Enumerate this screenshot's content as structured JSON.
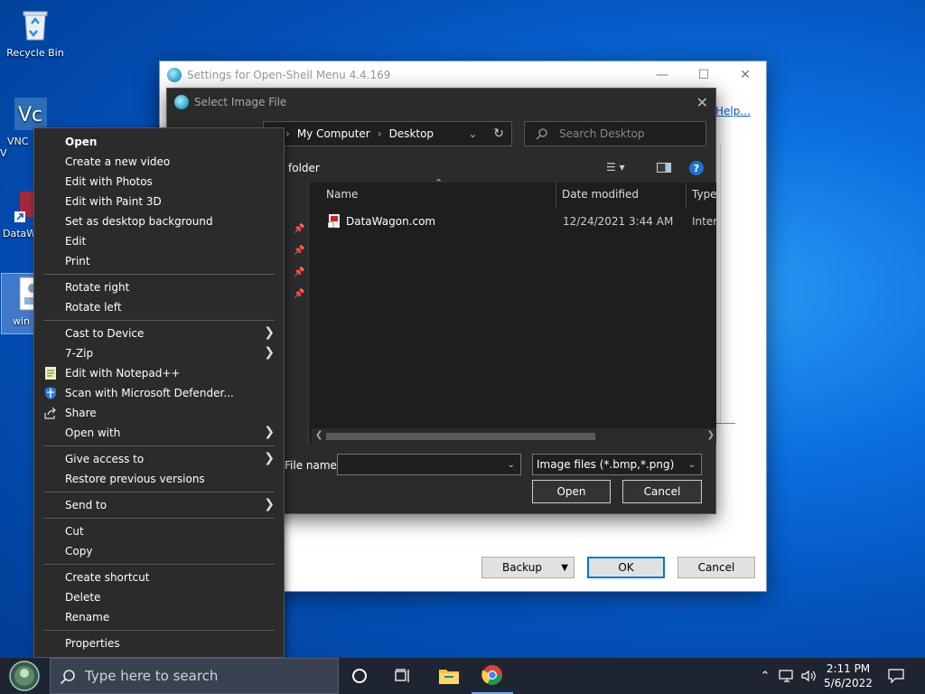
{
  "desktop": {
    "icons": [
      {
        "label": "Recycle Bin"
      },
      {
        "label": "VNC V"
      },
      {
        "label": "DataW"
      },
      {
        "label": "win"
      }
    ]
  },
  "settings": {
    "title": "Settings for Open-Shell Menu 4.4.169",
    "help_link": "Help...",
    "backup_label": "Backup",
    "ok_label": "OK",
    "cancel_label": "Cancel"
  },
  "dialog": {
    "title": "Select Image File",
    "breadcrumb": [
      "My Computer",
      "Desktop"
    ],
    "search_placeholder": "Search Desktop",
    "new_folder_label": "folder",
    "columns": {
      "name": "Name",
      "date": "Date modified",
      "type": "Type"
    },
    "files": [
      {
        "name": "DataWagon.com",
        "date": "12/24/2021 3:44 AM",
        "type": "Intern"
      }
    ],
    "file_name_label": "File name:",
    "file_name_value": "",
    "filter_value": "Image files (*.bmp,*.png)",
    "open_label": "Open",
    "cancel_label": "Cancel"
  },
  "context_menu": {
    "items": [
      {
        "label": "Open",
        "bold": true
      },
      {
        "label": "Create a new video"
      },
      {
        "label": "Edit with Photos"
      },
      {
        "label": "Edit with Paint 3D"
      },
      {
        "label": "Set as desktop background"
      },
      {
        "label": "Edit"
      },
      {
        "label": "Print"
      },
      {
        "label": "Rotate right"
      },
      {
        "label": "Rotate left"
      },
      {
        "label": "Cast to Device"
      },
      {
        "label": "7-Zip"
      },
      {
        "label": "Edit with Notepad++"
      },
      {
        "label": "Scan with Microsoft Defender..."
      },
      {
        "label": "Share"
      },
      {
        "label": "Open with"
      },
      {
        "label": "Give access to"
      },
      {
        "label": "Restore previous versions"
      },
      {
        "label": "Send to"
      },
      {
        "label": "Cut"
      },
      {
        "label": "Copy"
      },
      {
        "label": "Create shortcut"
      },
      {
        "label": "Delete"
      },
      {
        "label": "Rename"
      },
      {
        "label": "Properties"
      }
    ]
  },
  "taskbar": {
    "search_placeholder": "Type here to search",
    "time": "2:11 PM",
    "date": "5/6/2022"
  },
  "colors": {
    "accent": "#0078d7",
    "menu_bg": "#2b2b2b",
    "taskbar_bg": "#1f2530"
  }
}
